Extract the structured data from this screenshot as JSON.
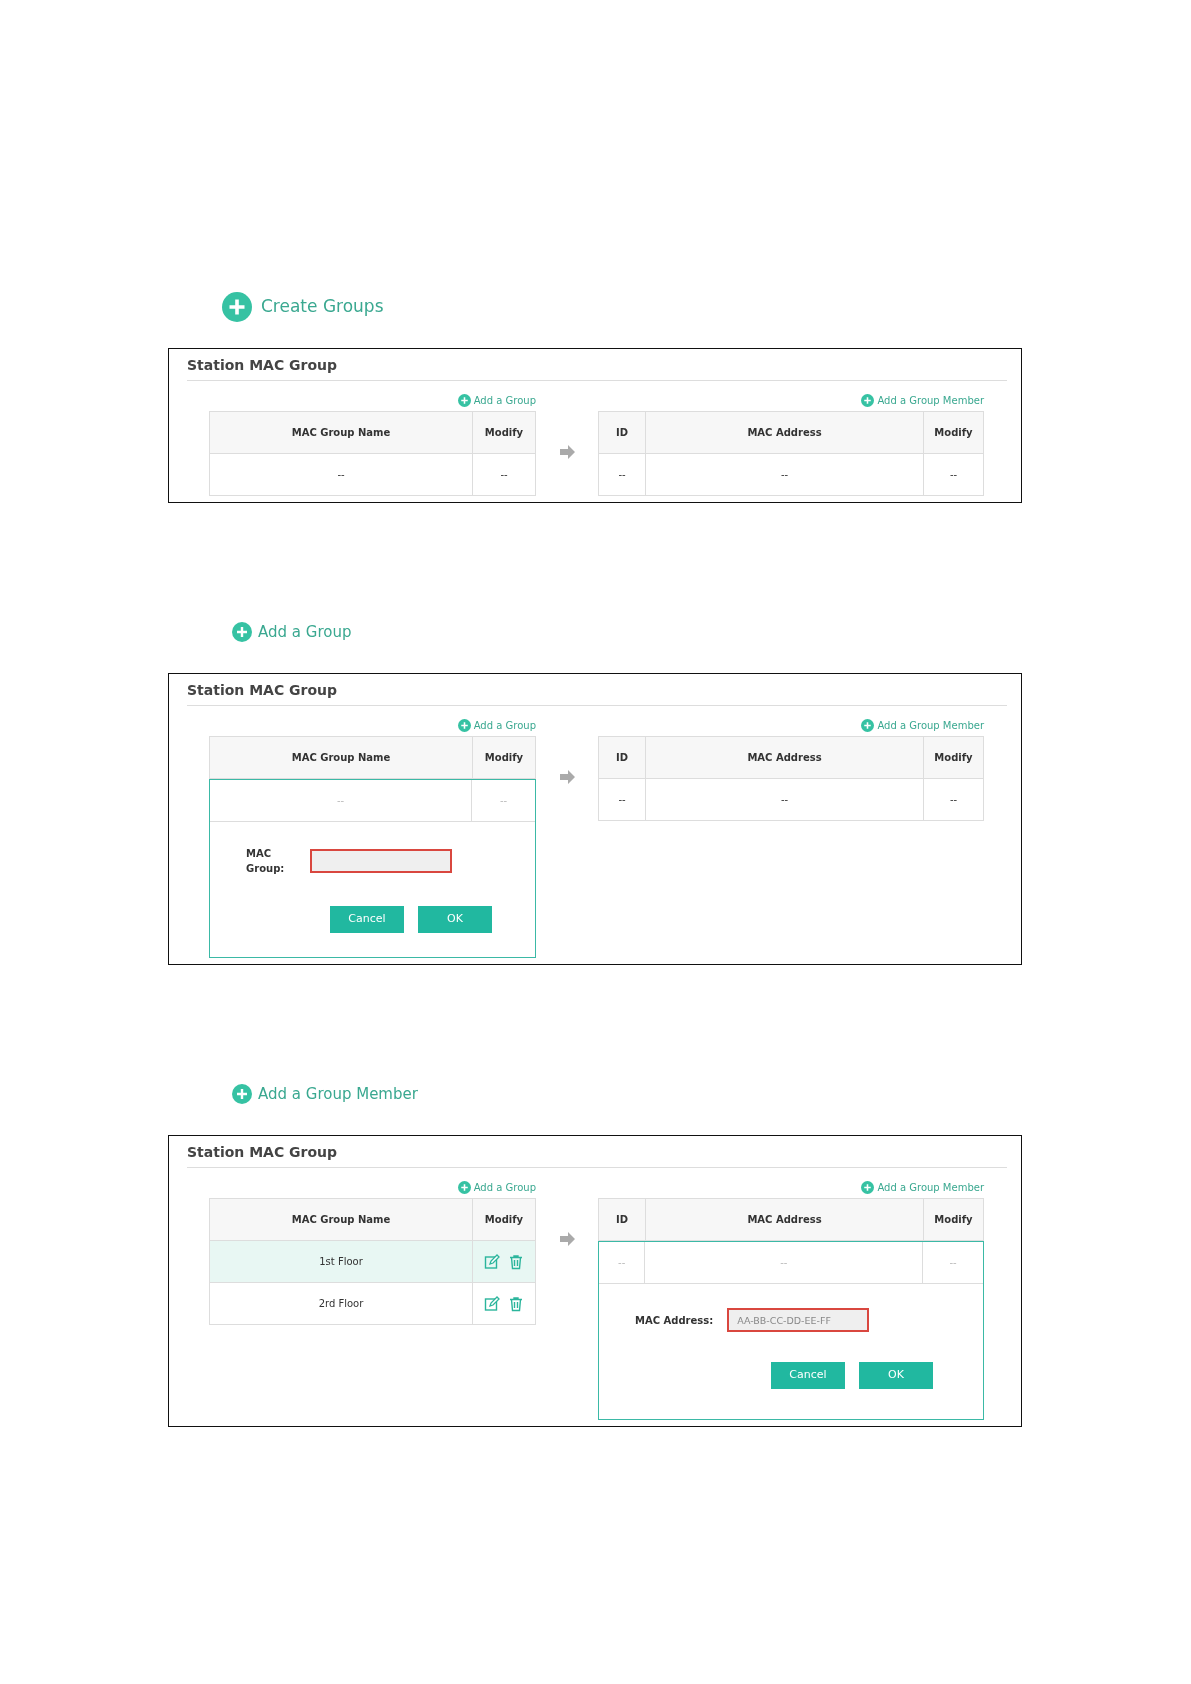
{
  "sections": [
    {
      "heading": {
        "text": "Create Groups",
        "large": true
      },
      "panel": {
        "title": "Station MAC Group",
        "group_table": {
          "add_link": "Add a Group",
          "columns": [
            "MAC Group Name",
            "Modify"
          ],
          "rows": [
            {
              "name": "--",
              "modify": {
                "kind": "text",
                "text": "--"
              },
              "selected": false,
              "muted": false
            }
          ]
        },
        "member_table": {
          "add_link": "Add a Group Member",
          "columns": [
            "ID",
            "MAC Address",
            "Modify"
          ],
          "rows": [
            {
              "cells": [
                "--",
                "--",
                "--"
              ],
              "muted": false
            }
          ]
        }
      }
    },
    {
      "heading": {
        "text": "Add a Group",
        "large": false
      },
      "panel": {
        "title": "Station MAC Group",
        "group_table": {
          "add_link": "Add a Group",
          "columns": [
            "MAC Group Name",
            "Modify"
          ],
          "rows": [
            {
              "name": "--",
              "modify": {
                "kind": "text",
                "text": "--"
              },
              "selected": false,
              "muted": true
            }
          ],
          "editor": {
            "label": "MAC Group:",
            "buttons": [
              "Cancel",
              "OK"
            ]
          }
        },
        "member_table": {
          "add_link": "Add a Group Member",
          "columns": [
            "ID",
            "MAC Address",
            "Modify"
          ],
          "rows": [
            {
              "cells": [
                "--",
                "--",
                "--"
              ],
              "muted": false
            }
          ]
        }
      }
    },
    {
      "heading": {
        "text": "Add a Group Member",
        "large": false
      },
      "panel": {
        "title": "Station MAC Group",
        "group_table": {
          "add_link": "Add a Group",
          "columns": [
            "MAC Group Name",
            "Modify"
          ],
          "rows": [
            {
              "name": "1st Floor",
              "modify": {
                "kind": "icons"
              },
              "selected": true,
              "muted": false
            },
            {
              "name": "2rd Floor",
              "modify": {
                "kind": "icons"
              },
              "selected": false,
              "muted": false
            }
          ]
        },
        "member_table": {
          "add_link": "Add a Group Member",
          "columns": [
            "ID",
            "MAC Address",
            "Modify"
          ],
          "rows": [
            {
              "cells": [
                "--",
                "--",
                "--"
              ],
              "muted": true
            }
          ],
          "editor": {
            "label": "MAC Address:",
            "placeholder": "AA-BB-CC-DD-EE-FF",
            "buttons": [
              "Cancel",
              "OK"
            ]
          }
        }
      }
    }
  ]
}
